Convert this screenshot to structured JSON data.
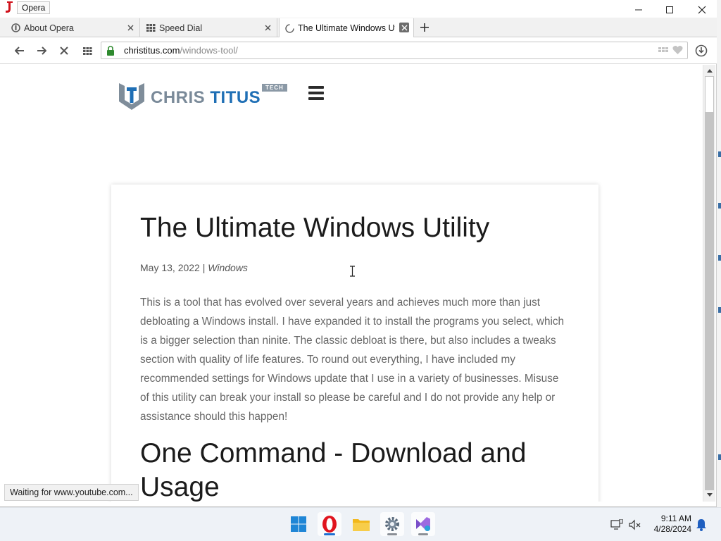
{
  "window": {
    "app_name": "Opera"
  },
  "tabs": [
    {
      "title": "About Opera",
      "icon": "opera-info-icon"
    },
    {
      "title": "Speed Dial",
      "icon": "speed-dial-icon"
    },
    {
      "title": "The Ultimate Windows Uti",
      "icon": "loading-spinner-icon",
      "active": true
    }
  ],
  "address": {
    "host": "christitus.com",
    "path": "/windows-tool/"
  },
  "site": {
    "logo_word1": "CHRIS ",
    "logo_word2": "TITUS",
    "logo_tag": "TECH"
  },
  "article": {
    "title": "The Ultimate Windows Utility",
    "date": "May 13, 2022",
    "separator": " | ",
    "category": "Windows",
    "body": "This is a tool that has evolved over several years and achieves much more than just debloating a Windows install. I have expanded it to install the programs you select, which is a bigger selection than ninite. The classic debloat is there, but also includes a tweaks section with quality of life features. To round out everything, I have included my recommended settings for Windows update that I use in a variety of businesses. Misuse of this utility can break your install so please be careful and I do not provide any help or assistance should this happen!",
    "section_title": "One Command - Download and Usage"
  },
  "status": {
    "text": "Waiting for www.youtube.com..."
  },
  "taskbar": {
    "apps": [
      "start-icon",
      "opera-icon",
      "file-explorer-icon",
      "settings-icon",
      "visual-studio-icon"
    ]
  },
  "clock": {
    "time": "9:11 AM",
    "date": "4/28/2024"
  },
  "colors": {
    "accent_blue": "#1f6fb5",
    "logo_gray": "#7a8a99",
    "opera_red": "#e0141e"
  }
}
